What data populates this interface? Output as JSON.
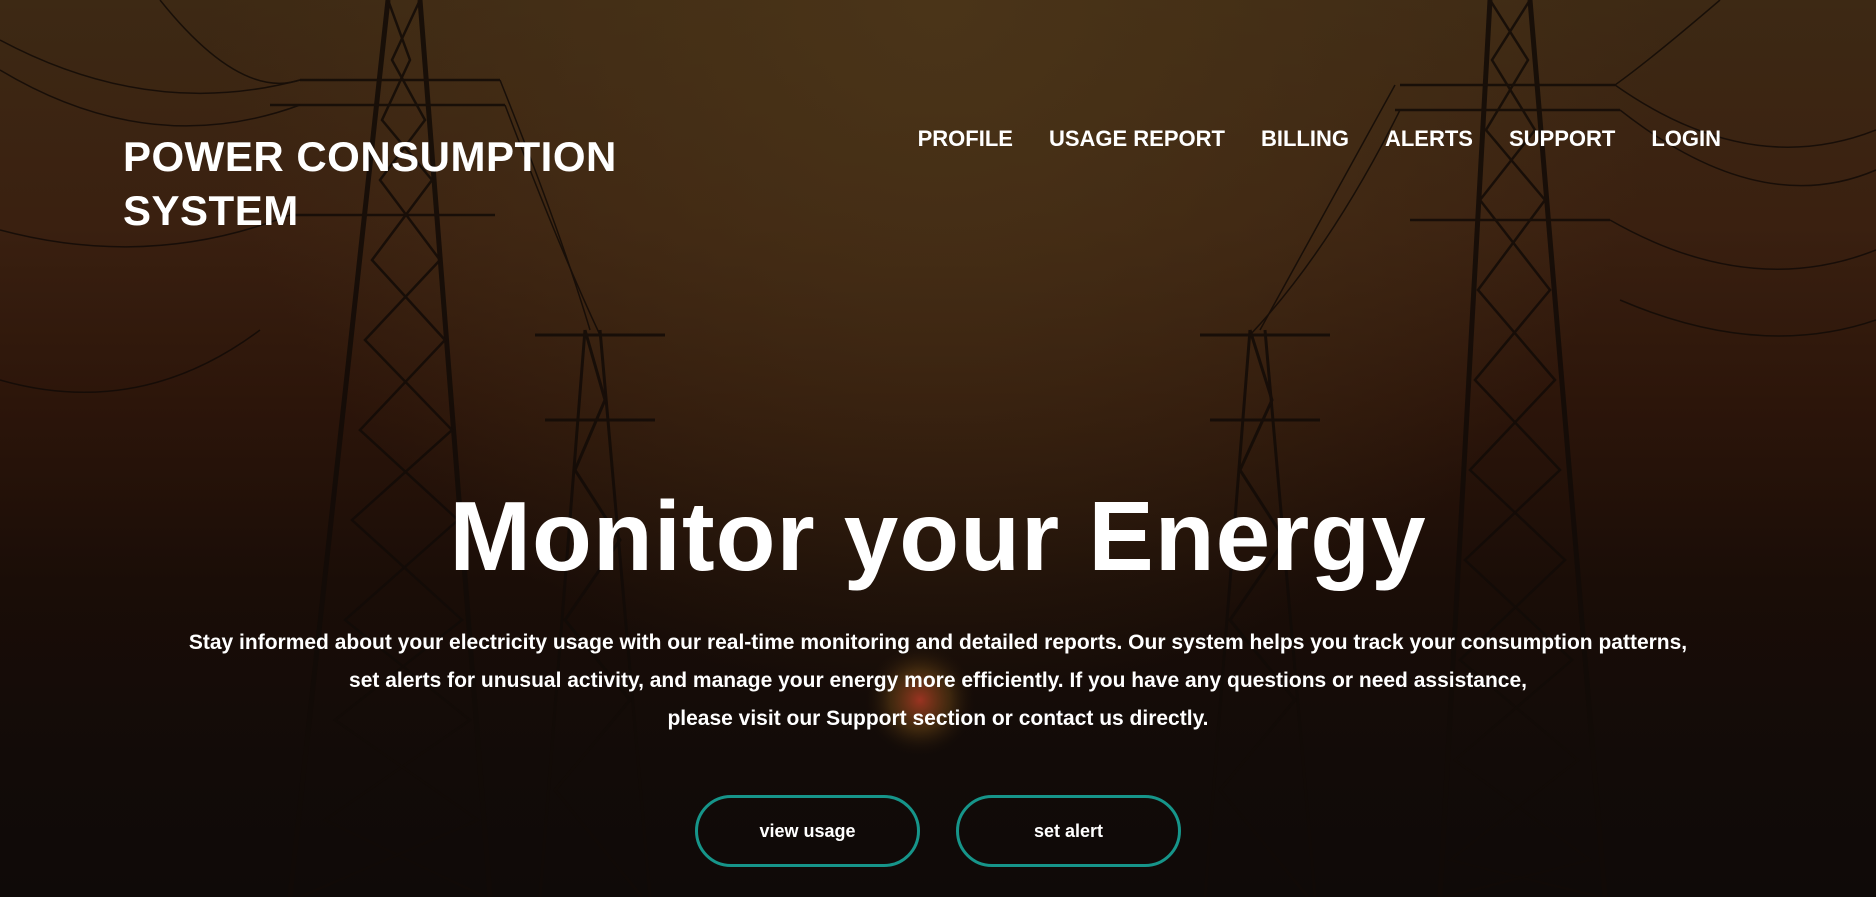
{
  "header": {
    "brand_line1": "POWER CONSUMPTION",
    "brand_line2": "SYSTEM"
  },
  "nav": {
    "items": [
      {
        "label": "PROFILE"
      },
      {
        "label": "USAGE REPORT"
      },
      {
        "label": "BILLING"
      },
      {
        "label": "ALERTS"
      },
      {
        "label": "SUPPORT"
      },
      {
        "label": "LOGIN"
      }
    ]
  },
  "hero": {
    "title": "Monitor your Energy",
    "description_lines": [
      "Stay informed about your electricity usage with our real-time monitoring and detailed reports. Our system helps you track your consumption patterns,",
      "set alerts for unusual activity, and manage your energy more efficiently. If you have any questions or need assistance,",
      "please visit our Support section or contact us directly."
    ],
    "buttons": {
      "view_usage": "view usage",
      "set_alert": "set alert"
    }
  },
  "colors": {
    "button_border": "#16958a",
    "text": "#ffffff",
    "background_top": "#3d2914",
    "background_bottom": "#0f0a08"
  }
}
